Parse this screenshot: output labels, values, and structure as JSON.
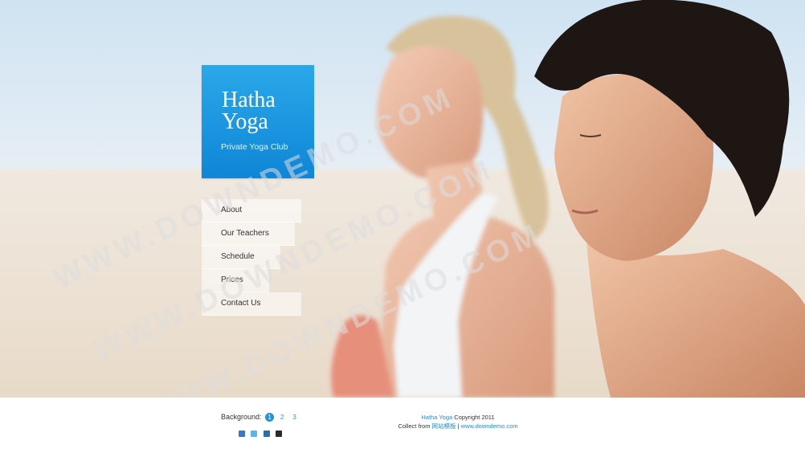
{
  "logo": {
    "title_line1": "Hatha",
    "title_line2": "Yoga",
    "subtitle": "Private Yoga Club"
  },
  "nav": {
    "items": [
      "About",
      "Our Teachers",
      "Schedule",
      "Prices",
      "Contact Us"
    ]
  },
  "footer": {
    "background_label": "Background:",
    "background_options": [
      "1",
      "2",
      "3"
    ],
    "background_selected": "1",
    "copyright_brand": "Hatha Yoga",
    "copyright_text": " Copyright 2011",
    "collect_prefix": "Collect from ",
    "collect_link1": "网站模板",
    "collect_sep": " | ",
    "collect_link2": "www.downdemo.com",
    "social_icons": [
      "facebook-icon",
      "twitter-icon",
      "linkedin-icon",
      "delicious-icon"
    ]
  },
  "watermark": "WWW.DOWNDEMO.COM",
  "colors": {
    "accent": "#1b8ed8",
    "logo_top": "#2aa8ea",
    "logo_bottom": "#0f86d6"
  }
}
